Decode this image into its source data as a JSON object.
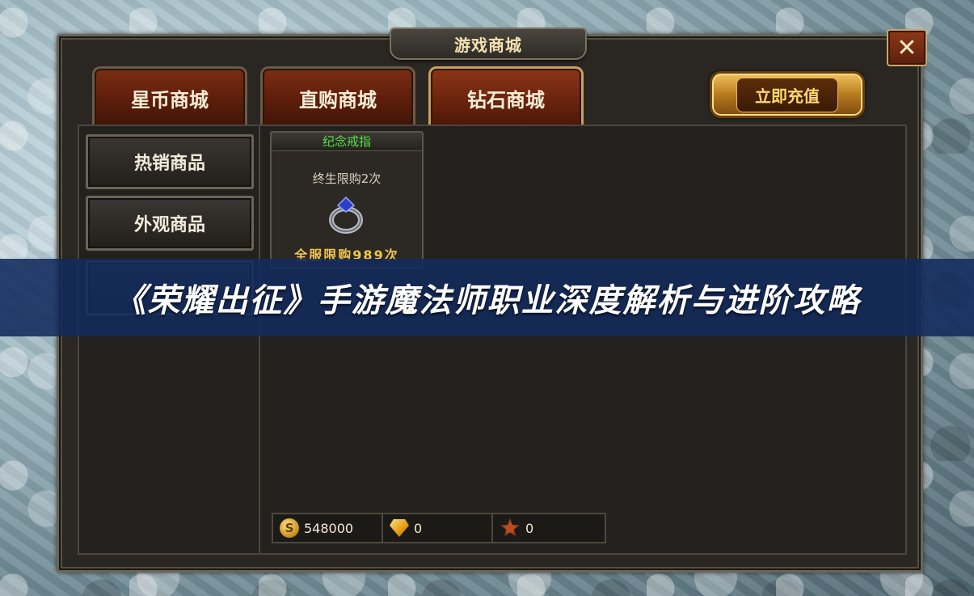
{
  "window": {
    "title": "游戏商城",
    "close_label": "✕"
  },
  "tabs": [
    {
      "label": "星币商城",
      "active": false
    },
    {
      "label": "直购商城",
      "active": false
    },
    {
      "label": "钻石商城",
      "active": true
    }
  ],
  "recharge_label": "立即充值",
  "sidebar": {
    "items": [
      {
        "label": "热销商品"
      },
      {
        "label": "外观商品"
      }
    ]
  },
  "item": {
    "name": "纪念戒指",
    "limit": "终生限购2次",
    "global_limit": "全服限购989次",
    "icon": "ring-icon"
  },
  "currencies": [
    {
      "icon": "coin-icon",
      "symbol": "S",
      "value": "548000"
    },
    {
      "icon": "gold-gem-icon",
      "value": "0"
    },
    {
      "icon": "star-emblem-icon",
      "value": "0"
    }
  ],
  "banner": {
    "text": "《荣耀出征》手游魔法师职业深度解析与进阶攻略"
  },
  "colors": {
    "item_title": "#58e04a",
    "global_limit": "#f0c64a",
    "banner_bg": "#122a5c"
  }
}
